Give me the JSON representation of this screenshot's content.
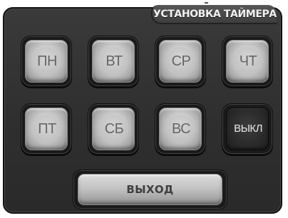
{
  "header": {
    "title": "УСТАНОВКА ТАЙМЕРА"
  },
  "days": [
    {
      "label": "ПН",
      "icon": "button"
    },
    {
      "label": "ВТ",
      "icon": "button"
    },
    {
      "label": "СР",
      "icon": "button"
    },
    {
      "label": "ЧТ",
      "icon": "button"
    },
    {
      "label": "ПТ",
      "icon": "button"
    },
    {
      "label": "СБ",
      "icon": "button"
    },
    {
      "label": "ВС",
      "icon": "button"
    }
  ],
  "off_button": {
    "label": "ВЫКЛ"
  },
  "exit_button": {
    "label": "ВЫХОД"
  },
  "colors": {
    "panel": "#333333",
    "button_face": "#c8c8c8",
    "button_text": "#666666",
    "off_face": "#2a2a2a",
    "off_text": "#e8e8e8",
    "title_text": "#f2f2f2"
  }
}
